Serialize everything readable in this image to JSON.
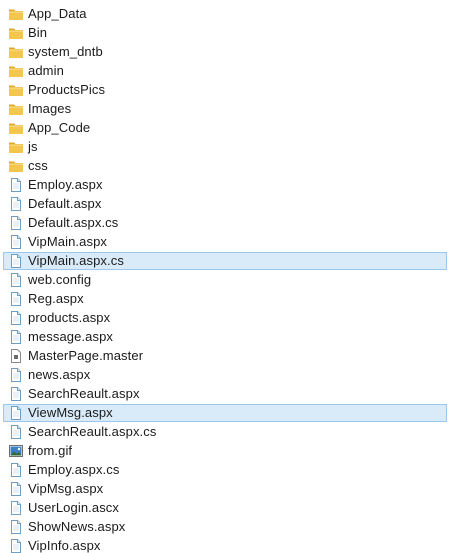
{
  "items": [
    {
      "name": "App_Data",
      "type": "folder",
      "selected": false
    },
    {
      "name": "Bin",
      "type": "folder",
      "selected": false
    },
    {
      "name": "system_dntb",
      "type": "folder",
      "selected": false
    },
    {
      "name": "admin",
      "type": "folder",
      "selected": false
    },
    {
      "name": "ProductsPics",
      "type": "folder",
      "selected": false
    },
    {
      "name": "Images",
      "type": "folder",
      "selected": false
    },
    {
      "name": "App_Code",
      "type": "folder",
      "selected": false
    },
    {
      "name": "js",
      "type": "folder",
      "selected": false
    },
    {
      "name": "css",
      "type": "folder",
      "selected": false
    },
    {
      "name": "Employ.aspx",
      "type": "file",
      "selected": false
    },
    {
      "name": "Default.aspx",
      "type": "file",
      "selected": false
    },
    {
      "name": "Default.aspx.cs",
      "type": "file",
      "selected": false
    },
    {
      "name": "VipMain.aspx",
      "type": "file",
      "selected": false
    },
    {
      "name": "VipMain.aspx.cs",
      "type": "file",
      "selected": true
    },
    {
      "name": "web.config",
      "type": "file",
      "selected": false
    },
    {
      "name": "Reg.aspx",
      "type": "file",
      "selected": false
    },
    {
      "name": "products.aspx",
      "type": "file",
      "selected": false
    },
    {
      "name": "message.aspx",
      "type": "file",
      "selected": false
    },
    {
      "name": "MasterPage.master",
      "type": "master",
      "selected": false
    },
    {
      "name": "news.aspx",
      "type": "file",
      "selected": false
    },
    {
      "name": "SearchReault.aspx",
      "type": "file",
      "selected": false
    },
    {
      "name": "ViewMsg.aspx",
      "type": "file",
      "selected": true
    },
    {
      "name": "SearchReault.aspx.cs",
      "type": "file",
      "selected": false
    },
    {
      "name": "from.gif",
      "type": "image",
      "selected": false
    },
    {
      "name": "Employ.aspx.cs",
      "type": "file",
      "selected": false
    },
    {
      "name": "VipMsg.aspx",
      "type": "file",
      "selected": false
    },
    {
      "name": "UserLogin.ascx",
      "type": "file",
      "selected": false
    },
    {
      "name": "ShowNews.aspx",
      "type": "file",
      "selected": false
    },
    {
      "name": "VipInfo.aspx",
      "type": "file",
      "selected": false
    }
  ],
  "colors": {
    "selection_background": "#d9ebf9",
    "selection_border": "#99c7ee",
    "folder_body": "#f3c64d",
    "folder_tab": "#e0a82e",
    "file_icon_border": "#6f9ec4",
    "image_icon_sky": "#3b7fc4"
  },
  "icons": {
    "folder": "folder-icon",
    "file": "document-icon",
    "master": "master-page-icon",
    "image": "image-file-icon"
  }
}
